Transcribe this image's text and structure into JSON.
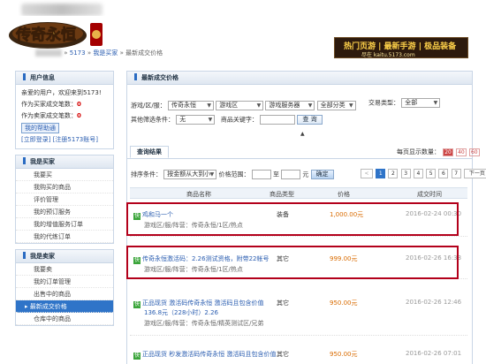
{
  "header": {
    "logo_text": "传奇永恒",
    "breadcrumb_sep1": "»",
    "breadcrumb_site": "5173",
    "breadcrumb_sep2": "»",
    "breadcrumb_page": "我是买家",
    "breadcrumb_sep3": "»",
    "breadcrumb_current": "最新成交价格",
    "banner_line1": "热门页游 | 最新手游 | 极品装备",
    "banner_line2": "尽在 kaitu.5173.com"
  },
  "sidebar": {
    "user_title": "用户信息",
    "welcome": "亲爱的用户，欢迎来到5173!",
    "buyer_score_label": "作为买家成交笔数：",
    "buyer_score": "0",
    "seller_score_label": "作为卖家成交笔数：",
    "seller_score": "0",
    "help_btn": "我的帮助通",
    "login": "[立即登录]",
    "register": "[注册5173账号]",
    "buyer_title": "我是买家",
    "buyer_items": [
      "我要买",
      "我购买的商品",
      "评价管理",
      "我的预订服务",
      "我的增值服务订单",
      "我的代练订单"
    ],
    "seller_title": "我是卖家",
    "seller_items": [
      "我要卖",
      "我的订单管理",
      "出售中的商品",
      "最新成交价格",
      "仓库中的商品"
    ],
    "active_index": 3
  },
  "main": {
    "title": "最新成交价格",
    "filter": {
      "game_label": "游戏/区/服：",
      "game": "传奇永恒",
      "area": "游戏区",
      "server": "游戏服务器",
      "category": "全部分类",
      "trade_type_label": "交易类型：",
      "trade_type": "全部",
      "other_label": "其他筛选条件：",
      "other": "无",
      "keyword_label": "商品关键字：",
      "search_btn": "查 询"
    },
    "results_tab": "查询结果",
    "per_page_label": "每页显示数量：",
    "per_page_options": [
      "20",
      "40",
      "60"
    ],
    "sort_label": "排序条件：",
    "sort_value": "按金额从大到小",
    "price_range_label": "价格范围：",
    "price_to": "至",
    "price_unit": "元",
    "confirm_btn": "确定",
    "pager": {
      "prev": "<",
      "pages": [
        "1",
        "2",
        "3",
        "4",
        "5",
        "6",
        "7"
      ],
      "current": "1",
      "next": "下一页"
    },
    "columns": [
      "商品名称",
      "商品类型",
      "价格",
      "成交时间"
    ],
    "rows": [
      {
        "badge": "快",
        "name": "鸡和马一个",
        "sub": "游戏区/服/阵营：传奇永恒/1区/热点",
        "type": "装备",
        "price": "1,000.00元",
        "date": "2016-02-24 00:30"
      },
      {
        "badge": "快",
        "name": "传奇永恒激活码：2.26测试资格，附带22帐号",
        "sub": "游戏区/服/阵营：传奇永恒/1区/热点",
        "type": "其它",
        "price": "999.00元",
        "date": "2016-02-26 16:33"
      },
      {
        "badge": "快",
        "name": "正品现货 激活码传奇永恒 激活码且包含价值",
        "name2": "136.8元（228小时）2.26",
        "sub": "游戏区/服/阵营：传奇永恒/精英测试区/兄弟",
        "type": "其它",
        "price": "950.00元",
        "date": "2016-02-26 12:46"
      },
      {
        "badge": "快",
        "name": "正品现货 秒发激活码传奇永恒 激活码且包含价值",
        "sub": "",
        "type": "其它",
        "price": "950.00元",
        "date": "2016-02-26 07:01"
      }
    ]
  }
}
